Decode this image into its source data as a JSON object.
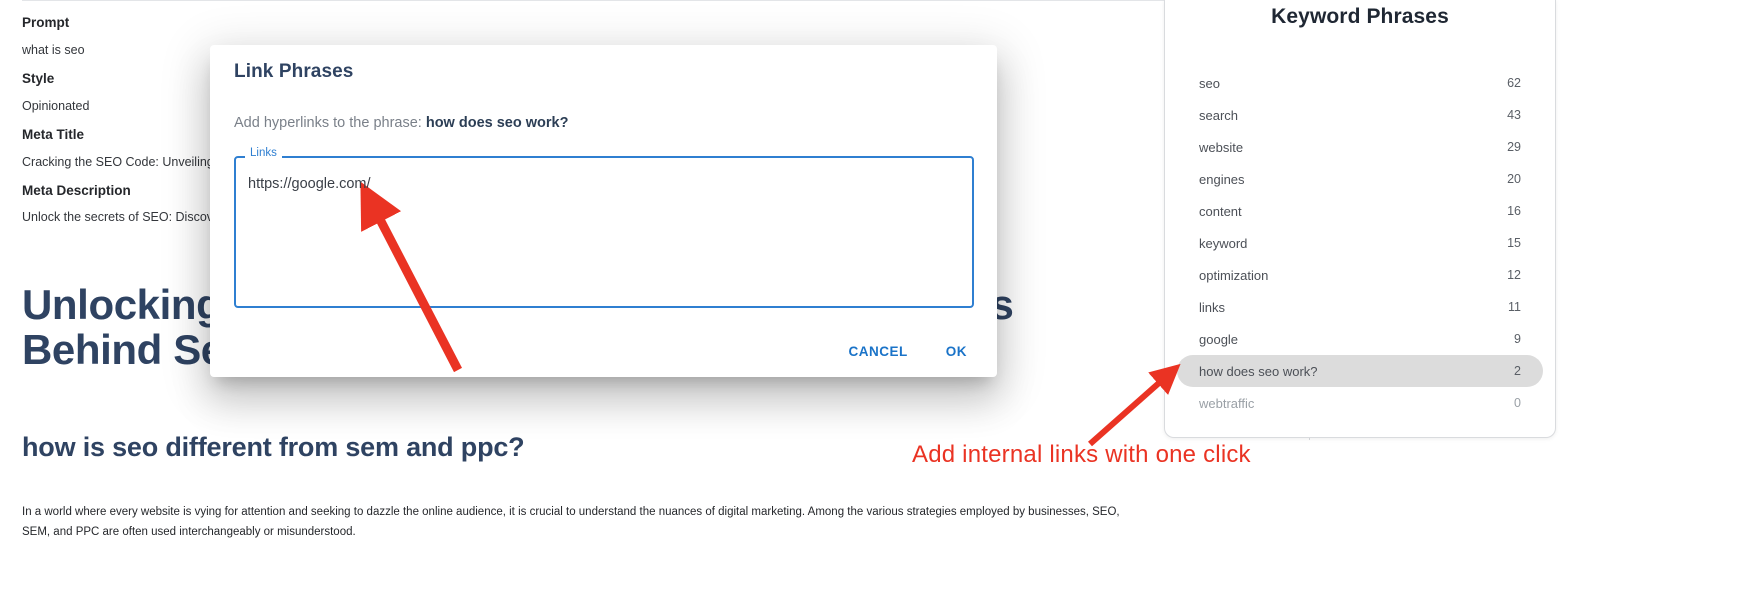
{
  "editor": {
    "meta_fields": [
      {
        "label": "Prompt",
        "value": "what is seo"
      },
      {
        "label": "Style",
        "value": "Opinionated"
      },
      {
        "label": "Meta Title",
        "value": "Cracking the SEO Code: Unveiling Search Engine Secrets"
      },
      {
        "label": "Meta Description",
        "value": "Unlock the secrets of SEO: Discover the essentials of search engine optimization"
      }
    ],
    "article": {
      "h1": "Unlocking the SEO Mystery: Revealing the Secrets Behind Search Engine Optimization",
      "h2": "how is seo different from sem and ppc?",
      "paragraph": "In a world where every website is vying for attention and seeking to dazzle the online audience, it is crucial to understand the nuances of digital marketing. Among the various strategies employed by businesses, SEO, SEM, and PPC are often used interchangeably or misunderstood."
    }
  },
  "modal": {
    "title": "Link Phrases",
    "subtitle_prefix": "Add hyperlinks to the phrase:",
    "subtitle_phrase": "how does seo work?",
    "field_legend": "Links",
    "field_value": "https://google.com/",
    "field_placeholder": "https://",
    "cancel_label": "CANCEL",
    "ok_label": "OK"
  },
  "sidebar": {
    "title": "Keyword Phrases",
    "keywords": [
      {
        "phrase": "seo",
        "count": "62",
        "state": "normal"
      },
      {
        "phrase": "search",
        "count": "43",
        "state": "normal"
      },
      {
        "phrase": "website",
        "count": "29",
        "state": "normal"
      },
      {
        "phrase": "engines",
        "count": "20",
        "state": "normal"
      },
      {
        "phrase": "content",
        "count": "16",
        "state": "normal"
      },
      {
        "phrase": "keyword",
        "count": "15",
        "state": "normal"
      },
      {
        "phrase": "optimization",
        "count": "12",
        "state": "normal"
      },
      {
        "phrase": "links",
        "count": "11",
        "state": "normal"
      },
      {
        "phrase": "google",
        "count": "9",
        "state": "normal"
      },
      {
        "phrase": "how does seo work?",
        "count": "2",
        "state": "selected"
      },
      {
        "phrase": "webtraffic",
        "count": "0",
        "state": "dim"
      }
    ]
  },
  "annotations": {
    "caption": "Add internal links with one click",
    "color": "#ea3323"
  }
}
